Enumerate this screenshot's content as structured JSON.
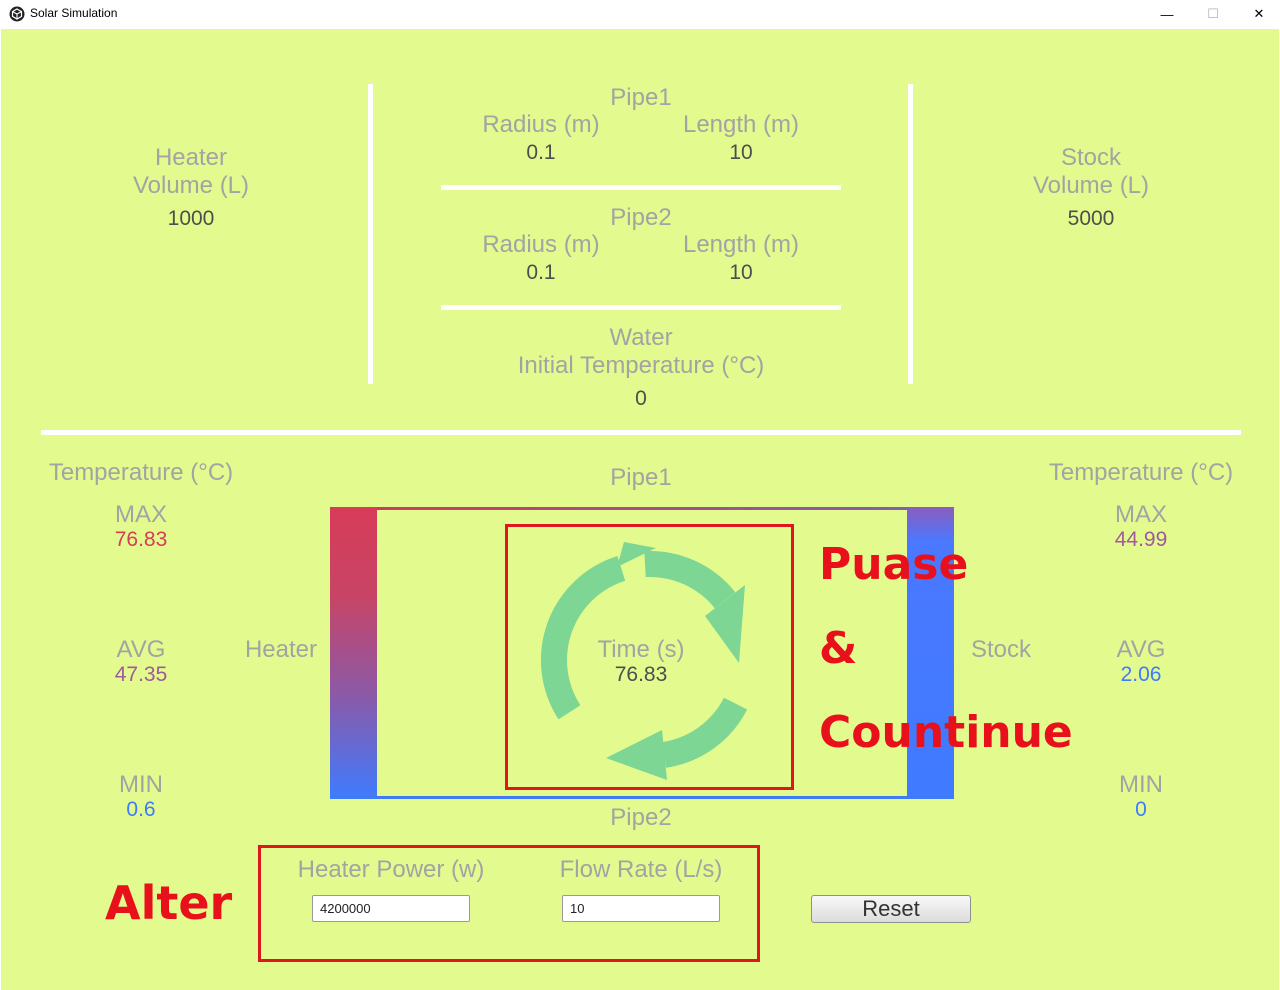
{
  "window": {
    "title": "Solar Simulation",
    "controls": {
      "minimize": "—",
      "maximize": "☐",
      "close": "✕"
    }
  },
  "config": {
    "heater": {
      "title_line1": "Heater",
      "title_line2": "Volume (L)",
      "volume": "1000"
    },
    "pipe1": {
      "title": "Pipe1",
      "radius_label": "Radius (m)",
      "length_label": "Length (m)",
      "radius": "0.1",
      "length": "10"
    },
    "pipe2": {
      "title": "Pipe2",
      "radius_label": "Radius (m)",
      "length_label": "Length (m)",
      "radius": "0.1",
      "length": "10"
    },
    "water": {
      "title_line1": "Water",
      "title_line2": "Initial Temperature (°C)",
      "initial_temp": "0"
    },
    "stock": {
      "title_line1": "Stock",
      "title_line2": "Volume (L)",
      "volume": "5000"
    }
  },
  "simulation": {
    "heater_stats": {
      "header": "Temperature (°C)",
      "max_label": "MAX",
      "max": "76.83",
      "avg_label": "AVG",
      "avg": "47.35",
      "min_label": "MIN",
      "min": "0.6"
    },
    "stock_stats": {
      "header": "Temperature (°C)",
      "max_label": "MAX",
      "max": "44.99",
      "avg_label": "AVG",
      "avg": "2.06",
      "min_label": "MIN",
      "min": "0"
    },
    "heater_label": "Heater",
    "stock_label": "Stock",
    "pipe1_label": "Pipe1",
    "pipe2_label": "Pipe2",
    "time_label": "Time (s)",
    "time": "76.83"
  },
  "controls": {
    "heater_power_label": "Heater Power (w)",
    "heater_power": "4200000",
    "flow_rate_label": "Flow Rate (L/s)",
    "flow_rate": "10",
    "reset_label": "Reset"
  },
  "annotations": {
    "pause_line1": "Puase",
    "pause_line2": "&",
    "pause_line3": "Countinue",
    "alter": "Alter"
  },
  "colors": {
    "background": "#e3fb8e",
    "label_gray": "#a3a3a3",
    "value_dark": "#4e4e4e",
    "hot_red": "#d73c58",
    "mid_purple": "#a05a9a",
    "cold_blue": "#3f7bff",
    "cycle_icon_green": "#7dd693",
    "annotation_red": "#e0161e"
  },
  "icons": {
    "app": "unity-cube-icon",
    "cycle": "refresh-cycle-icon"
  }
}
